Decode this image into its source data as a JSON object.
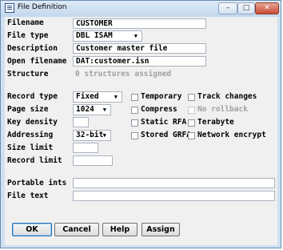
{
  "window": {
    "title": "File Definition",
    "minimize_label": "–",
    "maximize_label": "□",
    "close_label": "✕"
  },
  "form": {
    "filename": {
      "label": "Filename",
      "value": "CUSTOMER"
    },
    "file_type": {
      "label": "File type",
      "value": "DBL ISAM"
    },
    "description": {
      "label": "Description",
      "value": "Customer master file"
    },
    "open_filename": {
      "label": "Open filename",
      "value": "DAT:customer.isn"
    },
    "structure": {
      "label": "Structure",
      "value": "0 structures assigned"
    },
    "record_type": {
      "label": "Record type",
      "value": "Fixed"
    },
    "page_size": {
      "label": "Page size",
      "value": "1024"
    },
    "key_density": {
      "label": "Key density",
      "value": ""
    },
    "addressing": {
      "label": "Addressing",
      "value": "32-bit"
    },
    "size_limit": {
      "label": "Size limit",
      "value": ""
    },
    "record_limit": {
      "label": "Record limit",
      "value": ""
    },
    "portable_ints": {
      "label": "Portable ints",
      "value": ""
    },
    "file_text": {
      "label": "File text",
      "value": ""
    }
  },
  "checkboxes": {
    "temporary": {
      "label": "Temporary",
      "checked": false,
      "enabled": true
    },
    "track_changes": {
      "label": "Track changes",
      "checked": false,
      "enabled": true
    },
    "compress": {
      "label": "Compress",
      "checked": false,
      "enabled": true
    },
    "no_rollback": {
      "label": "No rollback",
      "checked": false,
      "enabled": false
    },
    "static_rfa": {
      "label": "Static RFA",
      "checked": false,
      "enabled": true
    },
    "terabyte": {
      "label": "Terabyte",
      "checked": false,
      "enabled": true
    },
    "stored_grfa": {
      "label": "Stored GRFA",
      "checked": false,
      "enabled": true
    },
    "network_encrypt": {
      "label": "Network encrypt",
      "checked": false,
      "enabled": true
    }
  },
  "buttons": {
    "ok": "OK",
    "cancel": "Cancel",
    "help": "Help",
    "assign": "Assign"
  },
  "icons": {
    "app": "window-icon",
    "dropdown": "chevron-down-icon"
  },
  "colors": {
    "frame": "#cfe0f2",
    "client": "#f0f0f0",
    "close_button": "#c74a33"
  }
}
